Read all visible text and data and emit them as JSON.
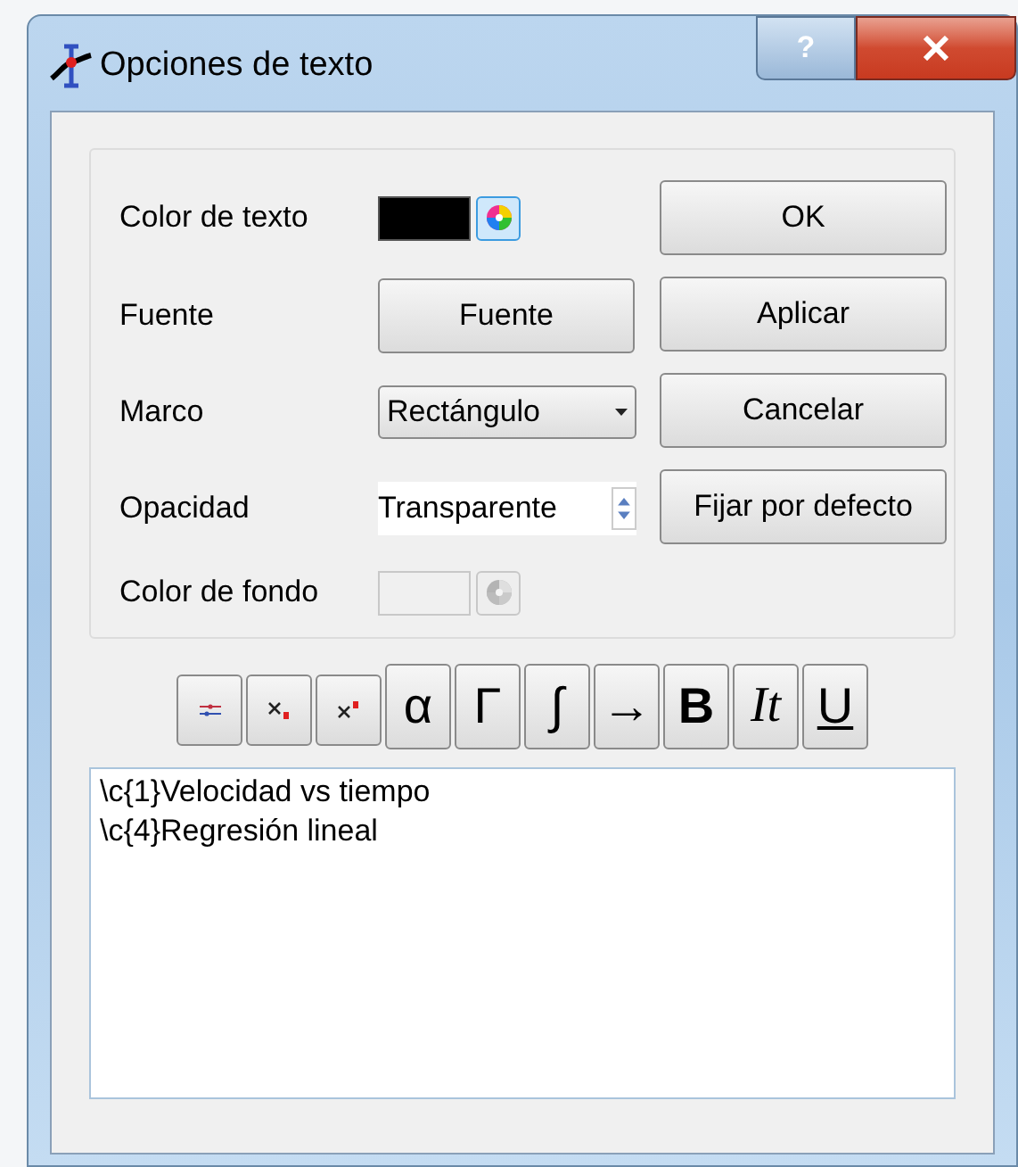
{
  "window": {
    "title": "Opciones de texto",
    "controls": [
      {
        "kind": "help",
        "label": "?"
      },
      {
        "kind": "close"
      }
    ]
  },
  "form": [
    {
      "label": "Color de texto",
      "kind": "color",
      "color": "#000000",
      "disabled": false
    },
    {
      "label": "Fuente",
      "kind": "button",
      "value": "Fuente"
    },
    {
      "label": "Marco",
      "kind": "dropdown",
      "value": "Rectángulo"
    },
    {
      "label": "Opacidad",
      "kind": "spin",
      "value": "Transparente"
    },
    {
      "label": "Color de fondo",
      "kind": "color",
      "disabled": true
    }
  ],
  "side_buttons": [
    "OK",
    "Aplicar",
    "Cancelar",
    "Fijar por defecto"
  ],
  "toolbar": [
    {
      "kind": "lines"
    },
    {
      "kind": "subscript"
    },
    {
      "kind": "superscript"
    },
    {
      "kind": "text",
      "label": "α"
    },
    {
      "kind": "text",
      "label": "Γ"
    },
    {
      "kind": "text",
      "label": "∫"
    },
    {
      "kind": "text",
      "label": "→"
    },
    {
      "kind": "bold",
      "label": "B"
    },
    {
      "kind": "italic",
      "label": "It"
    },
    {
      "kind": "underline",
      "label": "U"
    }
  ],
  "editor": {
    "lines": [
      "\\c{1}Velocidad vs tiempo",
      "\\c{4}Regresión lineal"
    ]
  }
}
